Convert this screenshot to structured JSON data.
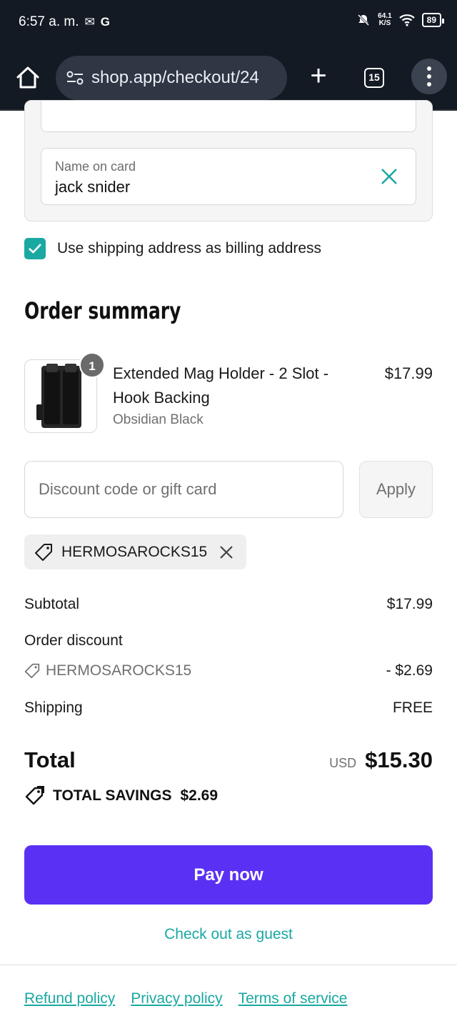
{
  "status_bar": {
    "time": "6:57 a. m.",
    "notif_icons": [
      "gmail-icon",
      "google-icon"
    ],
    "network_speed_value": "64.1",
    "network_speed_unit": "K/S",
    "battery": "89"
  },
  "browser": {
    "url": "shop.app/checkout/24",
    "tab_count": "15"
  },
  "payment": {
    "name_label": "Name on card",
    "name_value": "jack snider"
  },
  "billing": {
    "use_shipping_label": "Use shipping address as billing address",
    "checked": true
  },
  "order_summary": {
    "title": "Order summary",
    "items": [
      {
        "name": "Extended Mag Holder - 2 Slot - Hook Backing",
        "variant": "Obsidian Black",
        "price": "$17.99",
        "quantity": "1"
      }
    ],
    "discount_placeholder": "Discount code or gift card",
    "apply_label": "Apply",
    "applied_code": "HERMOSAROCKS15",
    "subtotal_label": "Subtotal",
    "subtotal_value": "$17.99",
    "order_discount_label": "Order discount",
    "discount_code": "HERMOSAROCKS15",
    "discount_value": "- $2.69",
    "shipping_label": "Shipping",
    "shipping_value": "FREE",
    "total_label": "Total",
    "total_currency": "USD",
    "total_value": "$15.30",
    "savings_label": "TOTAL SAVINGS",
    "savings_value": "$2.69"
  },
  "actions": {
    "pay_now": "Pay now",
    "guest_checkout": "Check out as guest"
  },
  "footer": {
    "links": [
      "Refund policy",
      "Privacy policy",
      "Terms of service"
    ]
  },
  "colors": {
    "accent": "#1aa8a2",
    "pay_button": "#5a31f4",
    "chrome_bg": "#141a24"
  }
}
